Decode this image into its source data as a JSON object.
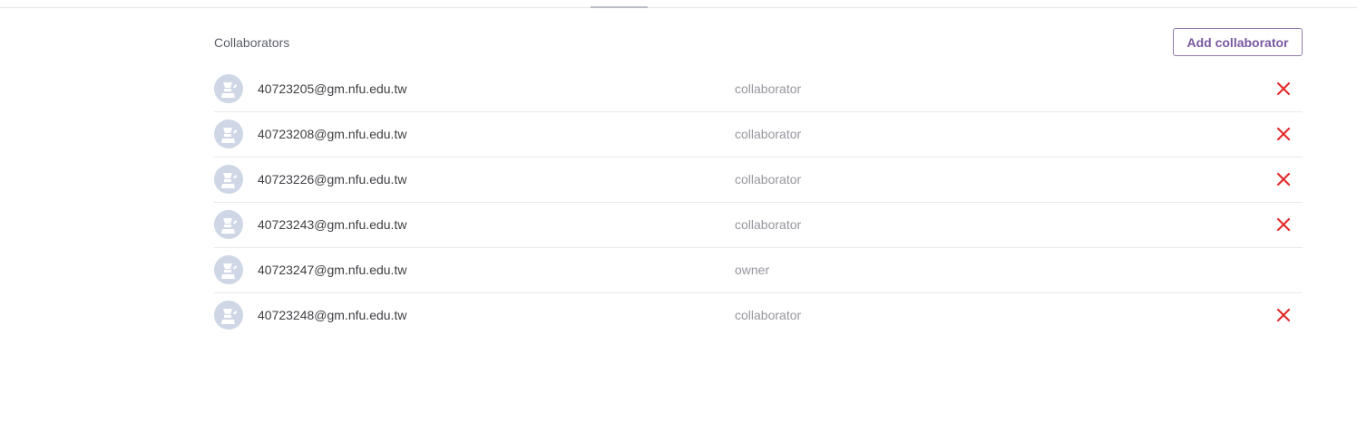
{
  "section": {
    "title": "Collaborators",
    "add_button_label": "Add collaborator"
  },
  "colors": {
    "accent": "#79589f",
    "remove": "#e32d2d",
    "avatar_bg": "#cfd7e6"
  },
  "collaborators": [
    {
      "email": "40723205@gm.nfu.edu.tw",
      "role": "collaborator",
      "removable": true
    },
    {
      "email": "40723208@gm.nfu.edu.tw",
      "role": "collaborator",
      "removable": true
    },
    {
      "email": "40723226@gm.nfu.edu.tw",
      "role": "collaborator",
      "removable": true
    },
    {
      "email": "40723243@gm.nfu.edu.tw",
      "role": "collaborator",
      "removable": true
    },
    {
      "email": "40723247@gm.nfu.edu.tw",
      "role": "owner",
      "removable": false
    },
    {
      "email": "40723248@gm.nfu.edu.tw",
      "role": "collaborator",
      "removable": true
    }
  ],
  "icons": {
    "avatar": "user-avatar-icon",
    "remove": "close-icon"
  }
}
